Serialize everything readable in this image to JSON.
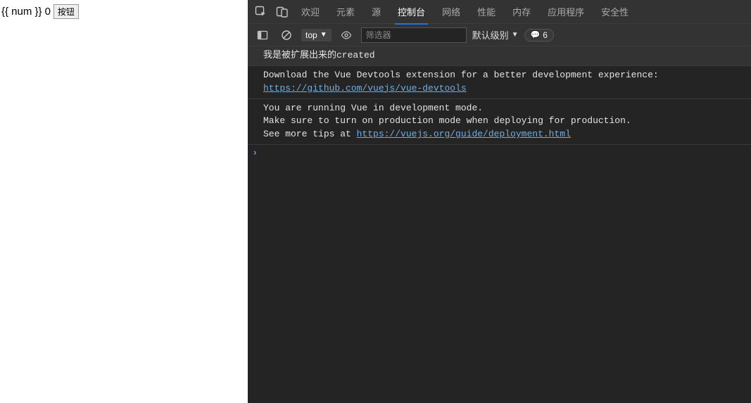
{
  "page": {
    "template_text": "{{ num }}",
    "rendered_value": "0",
    "button_label": "按钮"
  },
  "devtools": {
    "tabs": [
      {
        "label": "欢迎",
        "active": false
      },
      {
        "label": "元素",
        "active": false
      },
      {
        "label": "源",
        "active": false
      },
      {
        "label": "控制台",
        "active": true
      },
      {
        "label": "网络",
        "active": false
      },
      {
        "label": "性能",
        "active": false
      },
      {
        "label": "内存",
        "active": false
      },
      {
        "label": "应用程序",
        "active": false
      },
      {
        "label": "安全性",
        "active": false
      }
    ],
    "toolbar": {
      "context": "top",
      "filter_placeholder": "筛选器",
      "level_label": "默认级别",
      "info_count": "6"
    },
    "logs": [
      {
        "type": "log",
        "dark": true,
        "lines": [
          {
            "text": "我是被扩展出来的created"
          }
        ]
      },
      {
        "type": "log",
        "dark": false,
        "lines": [
          {
            "text": "Download the Vue Devtools extension for a better development experience:"
          },
          {
            "link": "https://github.com/vuejs/vue-devtools"
          }
        ]
      },
      {
        "type": "log",
        "dark": false,
        "lines": [
          {
            "text": "You are running Vue in development mode."
          },
          {
            "text": "Make sure to turn on production mode when deploying for production."
          },
          {
            "text": "See more tips at ",
            "inline_link": "https://vuejs.org/guide/deployment.html"
          }
        ]
      }
    ]
  }
}
